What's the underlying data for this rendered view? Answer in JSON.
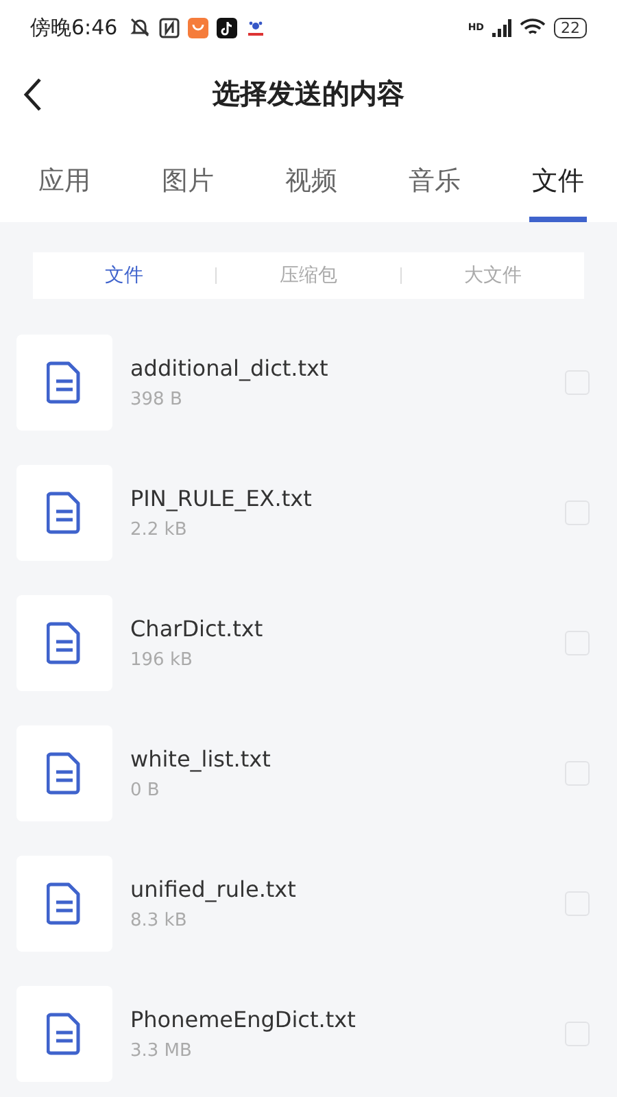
{
  "status_bar": {
    "time": "傍晚6:46",
    "network_label": "HD",
    "battery": "22"
  },
  "header": {
    "title": "选择发送的内容"
  },
  "tabs": [
    {
      "label": "应用",
      "selected": false
    },
    {
      "label": "图片",
      "selected": false
    },
    {
      "label": "视频",
      "selected": false
    },
    {
      "label": "音乐",
      "selected": false
    },
    {
      "label": "文件",
      "selected": true
    }
  ],
  "filters": [
    {
      "label": "文件",
      "selected": true
    },
    {
      "label": "压缩包",
      "selected": false
    },
    {
      "label": "大文件",
      "selected": false
    }
  ],
  "files": [
    {
      "name": "additional_dict.txt",
      "size": "398 B",
      "checked": false
    },
    {
      "name": "PIN_RULE_EX.txt",
      "size": "2.2 kB",
      "checked": false
    },
    {
      "name": "CharDict.txt",
      "size": "196 kB",
      "checked": false
    },
    {
      "name": "white_list.txt",
      "size": "0 B",
      "checked": false
    },
    {
      "name": "unified_rule.txt",
      "size": "8.3 kB",
      "checked": false
    },
    {
      "name": "PhonemeEngDict.txt",
      "size": "3.3 MB",
      "checked": false
    }
  ]
}
